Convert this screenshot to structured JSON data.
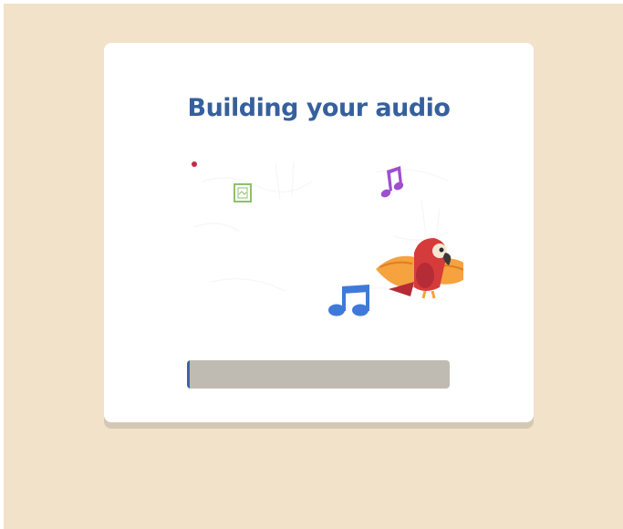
{
  "dialog": {
    "title": "Building your audio",
    "illustration_icon": "parrot-with-music-notes"
  },
  "progress": {
    "fraction": 0.01,
    "track_color": "#c0bbb2",
    "fill_color": "#3d64a8"
  },
  "colors": {
    "background": "#f1e2c9",
    "title": "#36609d"
  }
}
